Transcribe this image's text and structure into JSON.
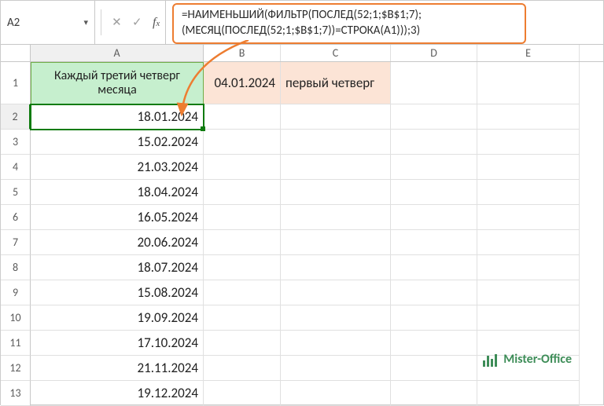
{
  "nameBox": {
    "value": "A2"
  },
  "formula": {
    "line1": "=НАИМЕНЬШИЙ(ФИЛЬТР(ПОСЛЕД(52;1;$B$1;7);",
    "line2": "(МЕСЯЦ(ПОСЛЕД(52;1;$B$1;7))=СТРОКА(A1)));3)"
  },
  "columns": {
    "A": "A",
    "B": "B",
    "C": "C",
    "D": "D",
    "E": "E"
  },
  "headerCell": "Каждый третий четверг месяца",
  "b1": "04.01.2024",
  "c1": "первый четверг",
  "rows": [
    {
      "n": "1"
    },
    {
      "n": "2",
      "a": "18.01.2024"
    },
    {
      "n": "3",
      "a": "15.02.2024"
    },
    {
      "n": "4",
      "a": "21.03.2024"
    },
    {
      "n": "5",
      "a": "18.04.2024"
    },
    {
      "n": "6",
      "a": "16.05.2024"
    },
    {
      "n": "7",
      "a": "20.06.2024"
    },
    {
      "n": "8",
      "a": "18.07.2024"
    },
    {
      "n": "9",
      "a": "15.08.2024"
    },
    {
      "n": "10",
      "a": "19.09.2024"
    },
    {
      "n": "11",
      "a": "17.10.2024"
    },
    {
      "n": "12",
      "a": "21.11.2024"
    },
    {
      "n": "13",
      "a": "19.12.2024"
    }
  ],
  "watermark": "Mister-Office"
}
